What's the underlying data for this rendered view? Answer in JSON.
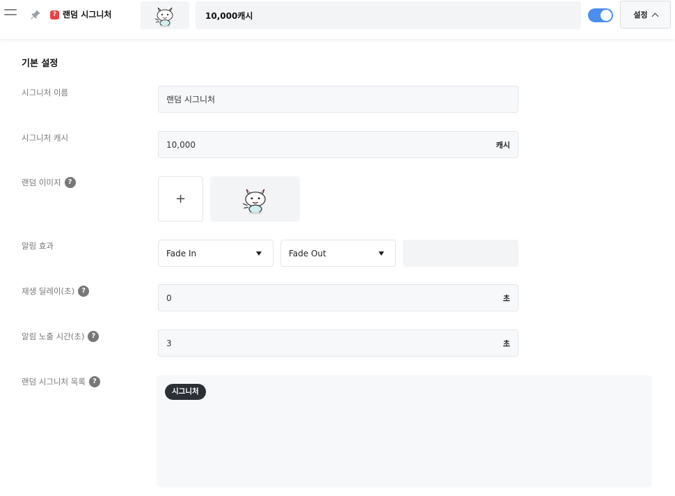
{
  "header": {
    "menu_icon": "menu-icon",
    "pin_icon": "pin-icon",
    "title_badge": "?",
    "title": "랜덤 시그니처",
    "amount": "10,000캐시",
    "toggle_on": true,
    "settings_label": "설정"
  },
  "section": {
    "title": "기본 설정"
  },
  "form": {
    "name_label": "시그니처 이름",
    "name_value": "랜덤 시그니처",
    "cash_label": "시그니처 캐시",
    "cash_value": "10,000",
    "cash_unit": "캐시",
    "image_label": "랜덤 이미지",
    "image_add": "+",
    "effect_label": "알림 효과",
    "effect_in": "Fade In",
    "effect_out": "Fade Out",
    "delay_label": "재생 딜레이(초)",
    "delay_value": "0",
    "delay_unit": "초",
    "duration_label": "알림 노출 시간(초)",
    "duration_value": "3",
    "duration_unit": "초",
    "list_label": "랜덤 시그니처 목록",
    "list_items": [
      "시그니처"
    ],
    "help": "?"
  },
  "colors": {
    "accent": "#4a8ff0",
    "chip_bg": "#2b2f36",
    "badge_red": "#e94444"
  }
}
